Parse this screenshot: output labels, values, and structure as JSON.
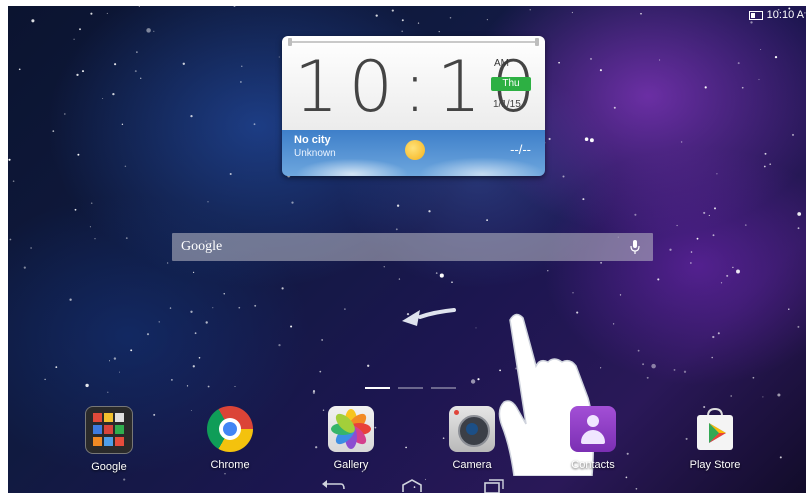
{
  "status_bar": {
    "time": "10:10 A"
  },
  "clock_widget": {
    "time": "10:10",
    "ampm": "AM",
    "day": "Thu",
    "date": "1/1/15",
    "weather": {
      "city": "No city",
      "status": "Unknown",
      "temperature": "--/--"
    }
  },
  "search": {
    "logo_text": "Google",
    "placeholder": ""
  },
  "home": {
    "page_count": 3,
    "active_page": 1
  },
  "dock": {
    "apps": [
      {
        "label": "Google",
        "icon": "google-folder-icon"
      },
      {
        "label": "Chrome",
        "icon": "chrome-icon"
      },
      {
        "label": "Gallery",
        "icon": "gallery-icon"
      },
      {
        "label": "Camera",
        "icon": "camera-icon"
      },
      {
        "label": "Contacts",
        "icon": "contacts-icon"
      },
      {
        "label": "Play Store",
        "icon": "play-store-icon"
      }
    ]
  },
  "nav": [
    "back-icon",
    "home-icon",
    "recents-icon"
  ],
  "colors": {
    "day_badge": "#2db043",
    "weather_blue": "#3e7fc9",
    "accent_purple": "#9b3fd6"
  }
}
